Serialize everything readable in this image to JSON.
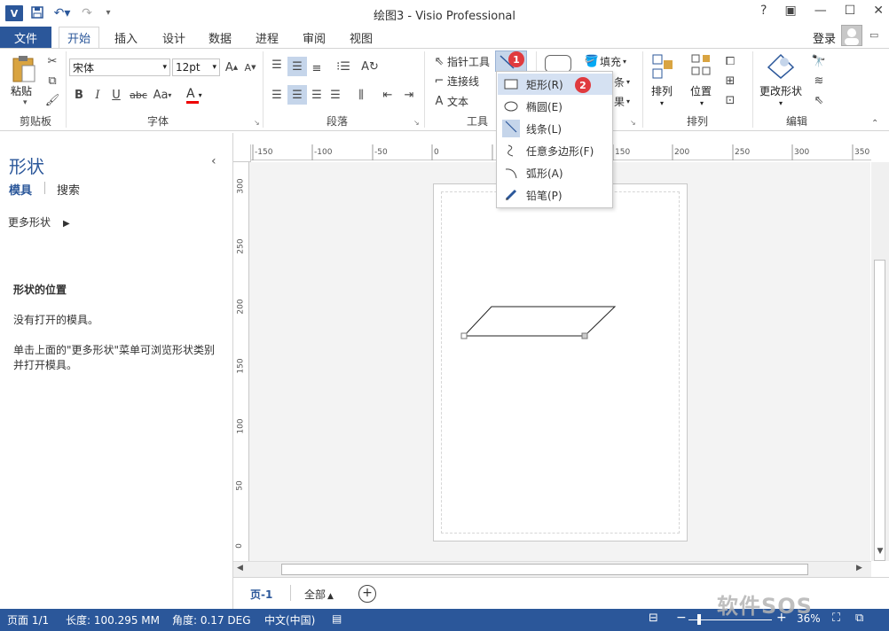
{
  "window": {
    "title": "绘图3 - Visio Professional",
    "help": "?",
    "login": "登录"
  },
  "qat": {
    "logo": "V"
  },
  "tabs": {
    "file": "文件",
    "items": [
      "开始",
      "插入",
      "设计",
      "数据",
      "进程",
      "审阅",
      "视图"
    ]
  },
  "ribbon": {
    "clipboard": {
      "paste": "粘贴",
      "label": "剪贴板"
    },
    "font": {
      "name": "宋体",
      "size": "12pt",
      "label": "字体",
      "bold": "B",
      "italic": "I",
      "underline": "U",
      "strike": "abc",
      "case": "Aa"
    },
    "paragraph": {
      "label": "段落"
    },
    "tools": {
      "pointer": "指针工具",
      "connector": "连接线",
      "text": "文本",
      "label": "工具"
    },
    "shape_style": {
      "fill": "填充",
      "line_partial": "条",
      "effect_partial": "果"
    },
    "arrange": {
      "arrange": "排列",
      "position": "位置",
      "label": "排列"
    },
    "edit": {
      "change_shape": "更改形状",
      "label": "编辑"
    }
  },
  "dropdown": {
    "items": [
      {
        "label": "矩形(R)",
        "icon": "rectangle-icon"
      },
      {
        "label": "椭圆(E)",
        "icon": "ellipse-icon"
      },
      {
        "label": "线条(L)",
        "icon": "line-icon"
      },
      {
        "label": "任意多边形(F)",
        "icon": "freeform-icon"
      },
      {
        "label": "弧形(A)",
        "icon": "arc-icon"
      },
      {
        "label": "铅笔(P)",
        "icon": "pencil-icon"
      }
    ]
  },
  "badges": {
    "one": "1",
    "two": "2"
  },
  "shapes_pane": {
    "title": "形状",
    "tab_stencils": "模具",
    "tab_search": "搜索",
    "more_shapes": "更多形状",
    "section_title": "形状的位置",
    "no_stencils": "没有打开的模具。",
    "hint_line1": "单击上面的\"更多形状\"菜单可浏览形状类别",
    "hint_line2": "并打开模具。"
  },
  "hruler_ticks": [
    "-150",
    "-100",
    "-50",
    "0",
    "150",
    "200",
    "250",
    "300",
    "350"
  ],
  "vruler_ticks": [
    "300",
    "250",
    "200",
    "150",
    "100",
    "50",
    "0"
  ],
  "page_tabs": {
    "page1": "页-1",
    "all": "全部"
  },
  "status": {
    "page": "页面 1/1",
    "length": "长度: 100.295 MM",
    "angle": "角度: 0.17 DEG",
    "language": "中文(中国)",
    "zoom": "36%"
  },
  "watermark": "软件SOS",
  "colors": {
    "accent": "#2b579a",
    "badge": "#e03a3e",
    "highlight": "#d5e1f2"
  }
}
